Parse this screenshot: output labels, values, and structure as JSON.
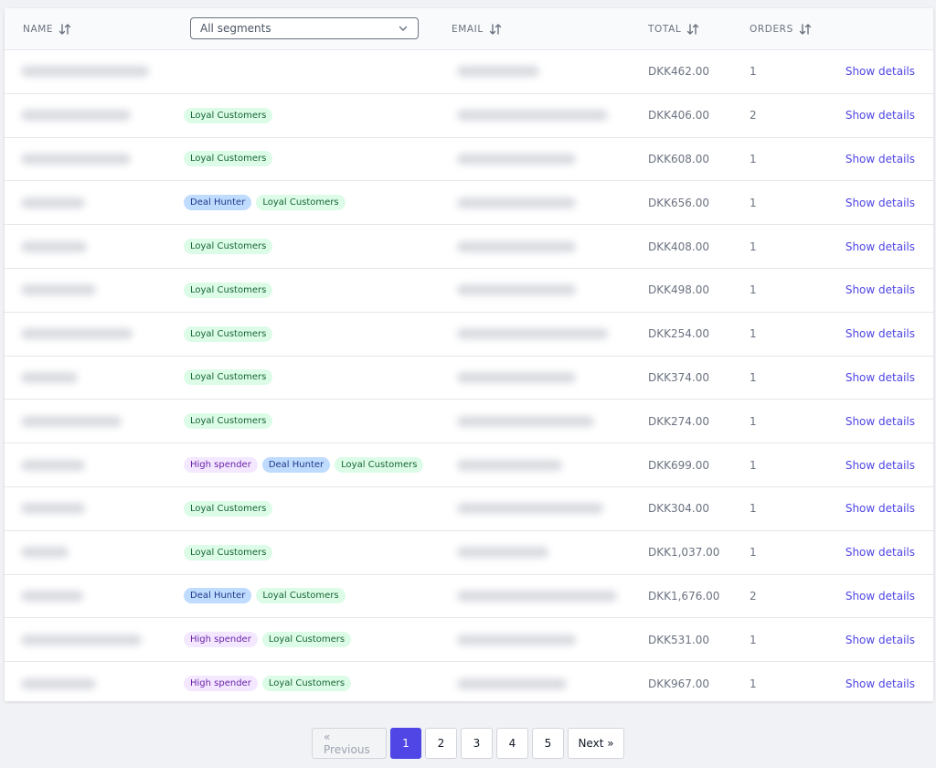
{
  "table": {
    "headers": {
      "name": "NAME",
      "email": "EMAIL",
      "total": "TOTAL",
      "orders": "ORDERS"
    },
    "segment_filter": {
      "selected": "All segments"
    },
    "details_label": "Show details",
    "rows": [
      {
        "segments": [],
        "total": "DKK462.00",
        "orders": "1"
      },
      {
        "segments": [
          "Loyal Customers"
        ],
        "total": "DKK406.00",
        "orders": "2"
      },
      {
        "segments": [
          "Loyal Customers"
        ],
        "total": "DKK608.00",
        "orders": "1"
      },
      {
        "segments": [
          "Deal Hunter",
          "Loyal Customers"
        ],
        "total": "DKK656.00",
        "orders": "1"
      },
      {
        "segments": [
          "Loyal Customers"
        ],
        "total": "DKK408.00",
        "orders": "1"
      },
      {
        "segments": [
          "Loyal Customers"
        ],
        "total": "DKK498.00",
        "orders": "1"
      },
      {
        "segments": [
          "Loyal Customers"
        ],
        "total": "DKK254.00",
        "orders": "1"
      },
      {
        "segments": [
          "Loyal Customers"
        ],
        "total": "DKK374.00",
        "orders": "1"
      },
      {
        "segments": [
          "Loyal Customers"
        ],
        "total": "DKK274.00",
        "orders": "1"
      },
      {
        "segments": [
          "High spender",
          "Deal Hunter",
          "Loyal Customers"
        ],
        "total": "DKK699.00",
        "orders": "1"
      },
      {
        "segments": [
          "Loyal Customers"
        ],
        "total": "DKK304.00",
        "orders": "1"
      },
      {
        "segments": [
          "Loyal Customers"
        ],
        "total": "DKK1,037.00",
        "orders": "1"
      },
      {
        "segments": [
          "Deal Hunter",
          "Loyal Customers"
        ],
        "total": "DKK1,676.00",
        "orders": "2"
      },
      {
        "segments": [
          "High spender",
          "Loyal Customers"
        ],
        "total": "DKK531.00",
        "orders": "1"
      },
      {
        "segments": [
          "High spender",
          "Loyal Customers"
        ],
        "total": "DKK967.00",
        "orders": "1"
      }
    ]
  },
  "pagination": {
    "previous": "« Previous",
    "pages": [
      "1",
      "2",
      "3",
      "4",
      "5"
    ],
    "current": "1",
    "next": "Next »"
  },
  "colors": {
    "accent": "#4f46e5",
    "loyal_bg": "#dcfce7",
    "deal_bg": "#bfdbfe",
    "high_bg": "#f3e8ff"
  }
}
